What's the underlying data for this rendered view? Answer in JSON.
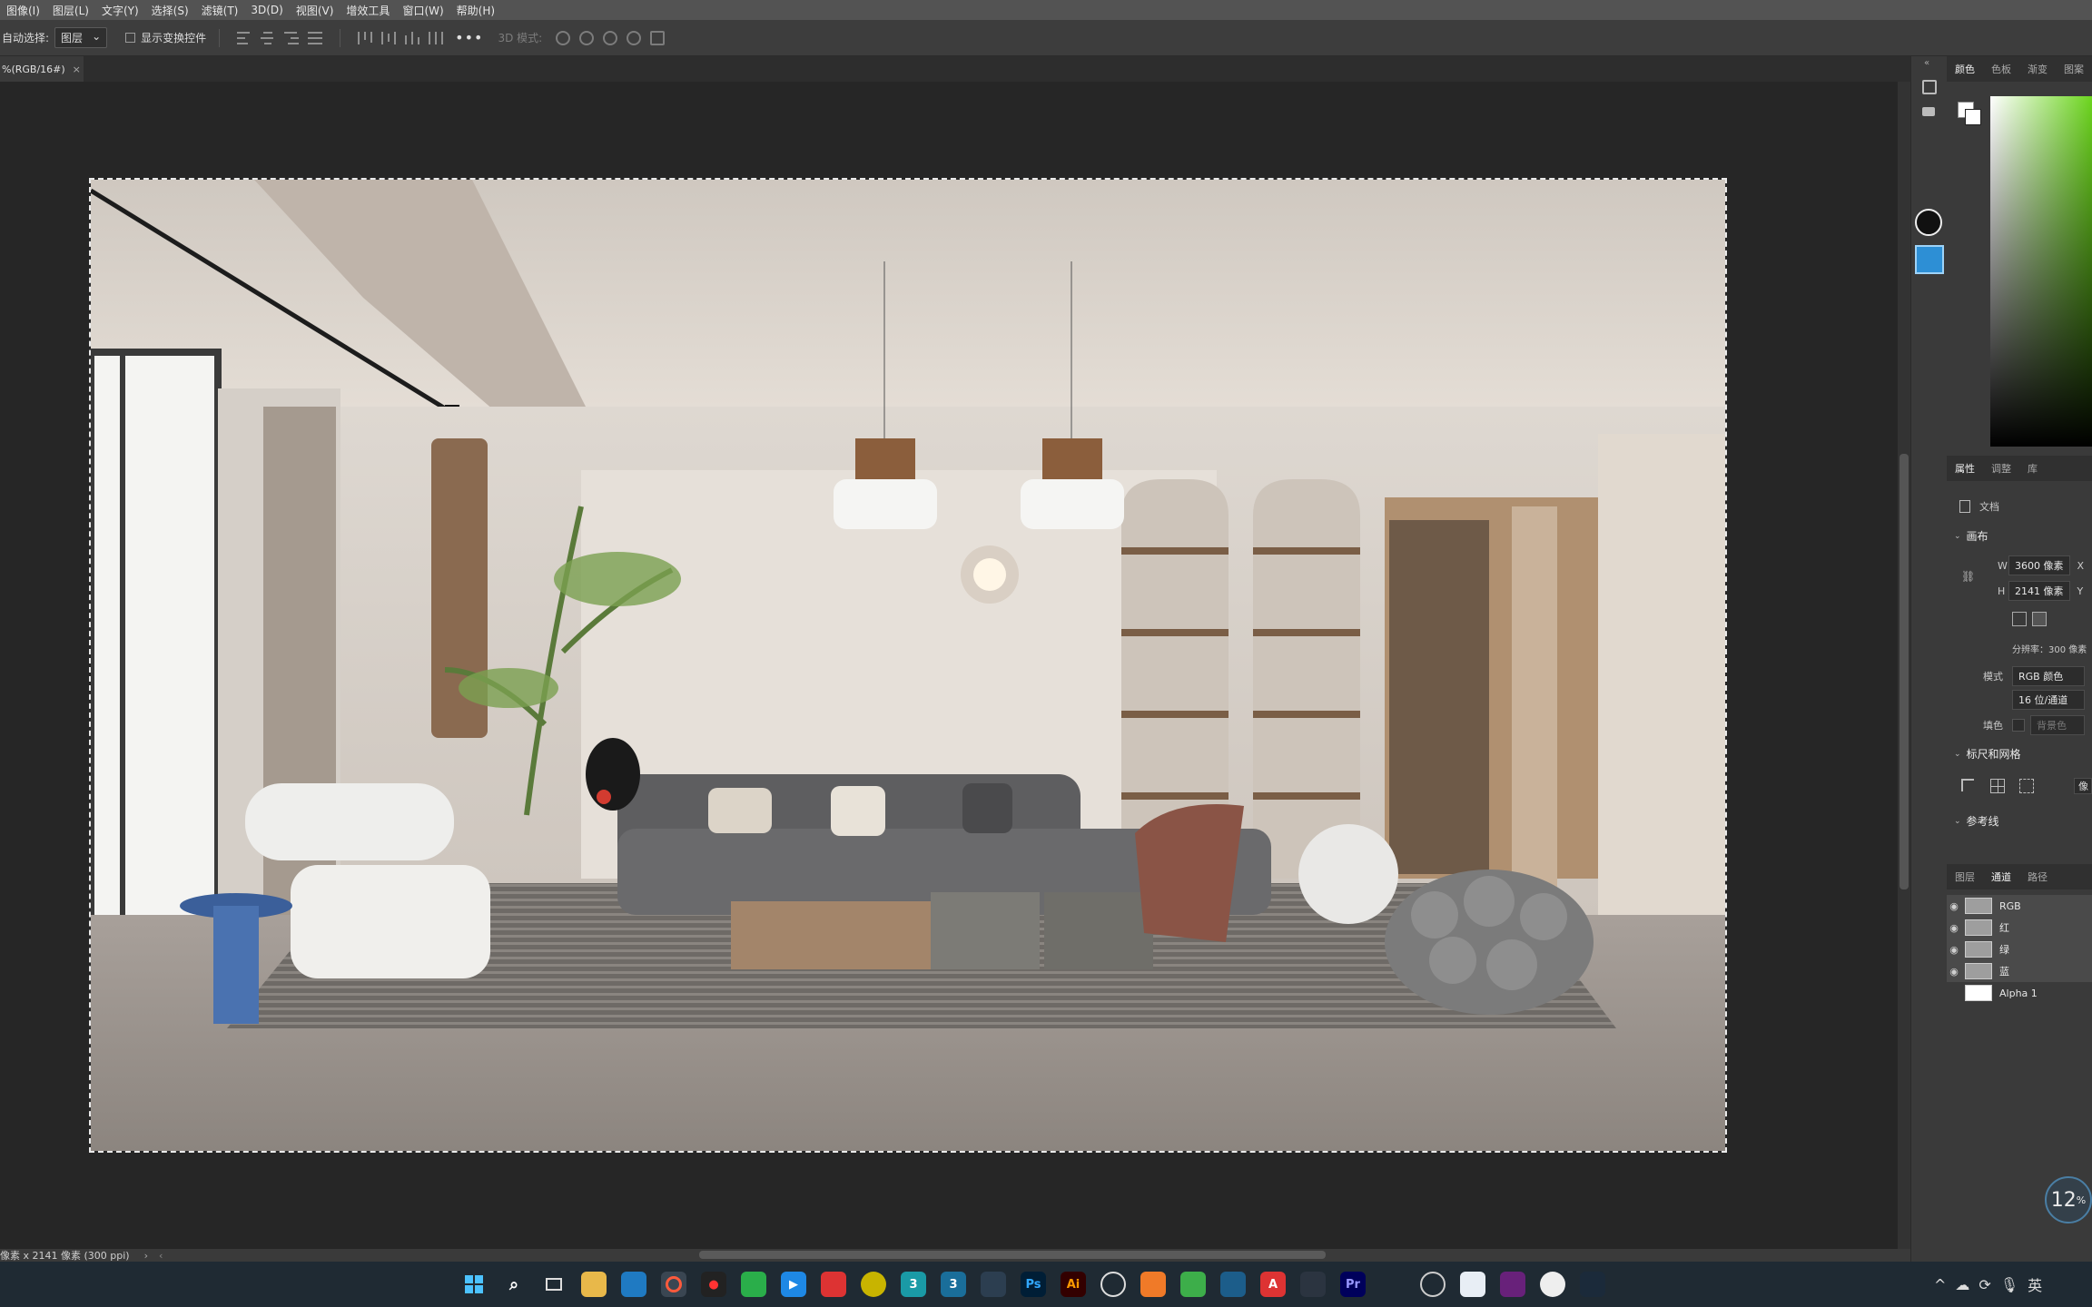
{
  "menu": [
    "图像(I)",
    "图层(L)",
    "文字(Y)",
    "选择(S)",
    "滤镜(T)",
    "3D(D)",
    "视图(V)",
    "增效工具",
    "窗口(W)",
    "帮助(H)"
  ],
  "options": {
    "auto_select_label": "自动选择:",
    "auto_select_value": "图层",
    "show_transform_label": "显示变换控件",
    "more": "•••",
    "mode_3d_label": "3D 模式:"
  },
  "document": {
    "tab_title": "%(RGB/16#)",
    "tab_close": "×",
    "status": "像素 x 2141 像素 (300 ppi)"
  },
  "panels": {
    "color_tabs": [
      "颜色",
      "色板",
      "渐变",
      "图案"
    ],
    "prop_tabs": [
      "属性",
      "调整",
      "库"
    ],
    "doc_label": "文档",
    "canvas_section": "画布",
    "width_label": "W",
    "width_value": "3600 像素",
    "height_label": "H",
    "height_value": "2141 像素",
    "x_label": "X",
    "y_label": "Y",
    "resolution": "分辨率：300 像素",
    "mode_label": "模式",
    "mode_value": "RGB 颜色",
    "depth_value": "16 位/通道",
    "fill_label": "填色",
    "fill_value": "背景色",
    "rulers_section": "标尺和网格",
    "units_btn": "像",
    "guides_section": "参考线",
    "layer_tabs": [
      "图层",
      "通道",
      "路径"
    ],
    "channels": [
      {
        "name": "RGB",
        "visible": true
      },
      {
        "name": "红",
        "visible": true
      },
      {
        "name": "绿",
        "visible": true
      },
      {
        "name": "蓝",
        "visible": true
      },
      {
        "name": "Alpha 1",
        "visible": false
      }
    ]
  },
  "zoom_badge": "12",
  "zoom_unit": "%",
  "taskbar": {
    "apps": [
      "Ps",
      "Ai",
      "Pr"
    ],
    "ime": "英"
  },
  "colors": {
    "accent_blue": "#2d8fd5",
    "ps_blue": "#31a8ff",
    "ai_orange": "#ff9a00",
    "pr_purple": "#9999ff"
  }
}
